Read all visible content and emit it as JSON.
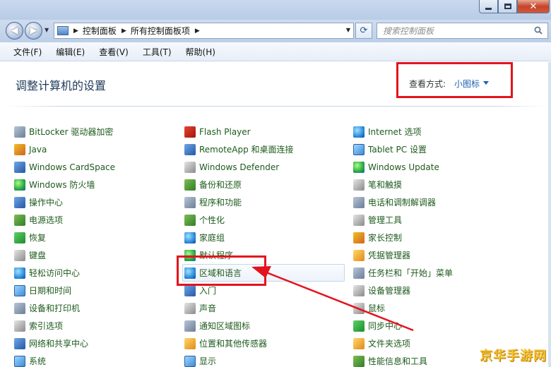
{
  "window": {
    "address_breadcrumbs": [
      "控制面板",
      "所有控制面板项"
    ],
    "search_placeholder": "搜索控制面板"
  },
  "menubar": {
    "items": [
      "文件(F)",
      "编辑(E)",
      "查看(V)",
      "工具(T)",
      "帮助(H)"
    ]
  },
  "content": {
    "heading": "调整计算机的设置",
    "view_label": "查看方式:",
    "view_value": "小图标"
  },
  "columns": [
    [
      "BitLocker 驱动器加密",
      "Java",
      "Windows CardSpace",
      "Windows 防火墙",
      "操作中心",
      "电源选项",
      "恢复",
      "键盘",
      "轻松访问中心",
      "日期和时间",
      "设备和打印机",
      "索引选项",
      "网络和共享中心",
      "系统"
    ],
    [
      "Flash Player",
      "RemoteApp 和桌面连接",
      "Windows Defender",
      "备份和还原",
      "程序和功能",
      "个性化",
      "家庭组",
      "默认程序",
      "区域和语言",
      "入门",
      "声音",
      "通知区域图标",
      "位置和其他传感器",
      "显示"
    ],
    [
      "Internet 选项",
      "Tablet PC 设置",
      "Windows Update",
      "笔和触摸",
      "电话和调制解调器",
      "管理工具",
      "家长控制",
      "凭据管理器",
      "任务栏和「开始」菜单",
      "设备管理器",
      "鼠标",
      "同步中心",
      "文件夹选项",
      "性能信息和工具"
    ]
  ],
  "highlighted_item": "区域和语言",
  "watermark": "京华手游网",
  "colors": {
    "link_green": "#1d5a1d",
    "heading_blue": "#1e395b",
    "annotation_red": "#e3141e"
  }
}
